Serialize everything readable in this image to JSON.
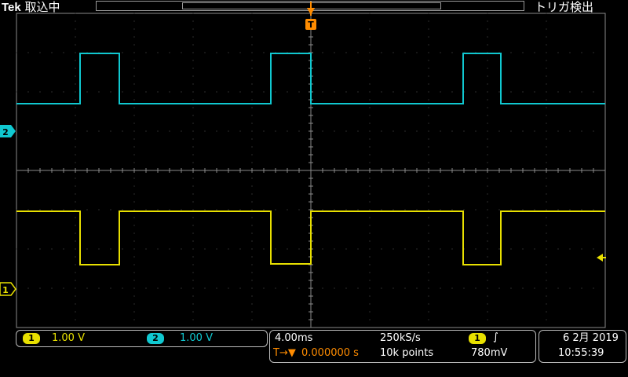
{
  "header": {
    "brand": "Tek",
    "acq_state": "取込中",
    "trigger_status": "トリガ検出"
  },
  "markers": {
    "trigger_top": "T",
    "ch2": "2",
    "ch1": "1"
  },
  "channels": [
    {
      "id": "1",
      "scale": "1.00 V",
      "color": "#e8e000"
    },
    {
      "id": "2",
      "scale": "1.00 V",
      "color": "#10c8d0"
    }
  ],
  "horizontal": {
    "timebase": "4.00ms",
    "sample_rate": "250kS/s",
    "record_length": "10k points",
    "trigger_position": "0.000000 s",
    "trigger_icon": "T→▼"
  },
  "trigger": {
    "source": "1",
    "slope_icon": "rising-edge-icon",
    "slope_glyph": "∫",
    "level": "780mV"
  },
  "datetime": {
    "date": "6 2月 2019",
    "time": "10:55:39"
  },
  "colors": {
    "grid": "#5a5a5a",
    "frame": "#8a8a8a",
    "ch1": "#e8e000",
    "ch2": "#10c8d0",
    "trigger": "#ff8c00"
  }
}
